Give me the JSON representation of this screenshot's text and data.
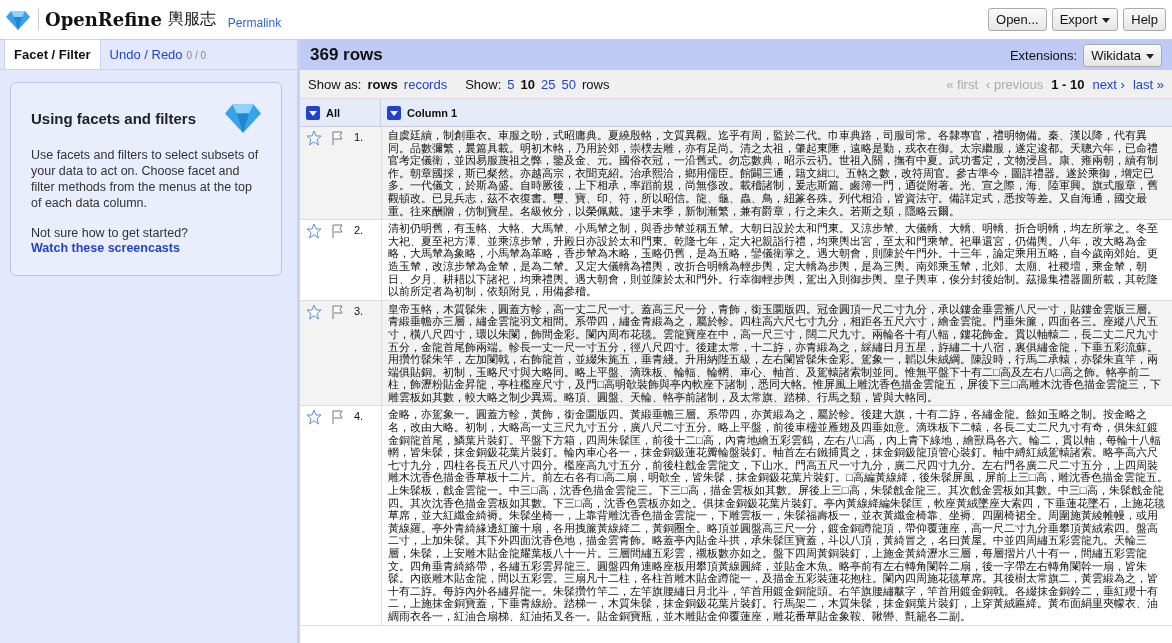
{
  "header": {
    "logo": "OpenRefine",
    "project_name": "輿服志",
    "permalink": "Permalink",
    "buttons": [
      {
        "label": "Open...",
        "has_menu": false
      },
      {
        "label": "Export",
        "has_menu": true
      },
      {
        "label": "Help",
        "has_menu": false
      }
    ]
  },
  "left_panel": {
    "tabs": [
      {
        "label": "Facet / Filter",
        "selected": true
      },
      {
        "label": "Undo / Redo",
        "count": "0 / 0",
        "selected": false
      }
    ],
    "help_card": {
      "title": "Using facets and filters",
      "body": "Use facets and filters to select subsets of your data to act on. Choose facet and filter methods from the menus at the top of each data column.",
      "question": "Not sure how to get started?",
      "link": "Watch these screencasts"
    }
  },
  "main": {
    "row_count": "369 rows",
    "extensions_label": "Extensions:",
    "extensions_button": "Wikidata",
    "show_as_label": "Show as:",
    "show_as": [
      {
        "label": "rows",
        "selected": true
      },
      {
        "label": "records",
        "selected": false
      }
    ],
    "show_label": "Show:",
    "page_sizes": [
      {
        "label": "5",
        "selected": false
      },
      {
        "label": "10",
        "selected": true
      },
      {
        "label": "25",
        "selected": false
      },
      {
        "label": "50",
        "selected": false
      }
    ],
    "rows_label": "rows",
    "pager": {
      "back": [
        {
          "label": "« first",
          "disabled": true
        },
        {
          "label": "‹ previous",
          "disabled": true
        }
      ],
      "range": "1 - 10",
      "forward": [
        {
          "label": "next ›",
          "disabled": false
        },
        {
          "label": "last »",
          "disabled": false
        }
      ]
    },
    "columns": [
      {
        "label": "All"
      },
      {
        "label": "Column 1"
      }
    ],
    "rows": [
      {
        "number": "1.",
        "starred": false,
        "flagged": false,
        "text": "自虞廷續，制創垂衣。車服之昐，式昭庸典。夏繞殷輅，文質異觀。迄乎有周，監於二代。巾車典路，司服司常。各隸專官，禮明物備。秦、漢以降，代有異同。品數彌繁，曩篇具載。明初木輅，乃用於郊，崇樸去雕，亦有足尚。清之太祖，肇起東陲，遠略是勤，戎衣在御。太宗繼服，遂定逡都。天聰六年，已命禮官考定儀衛，並因易服蔑祖之弊，鑒及金、元。國俗衣冠，一沿舊式。勿忘數典，昭示云礽。世祖入關，撫有中夏。武功耆定，文物浸昌。康、雍兩朝，續有制作。朝章國採，斯已粲然。亦越高宗，衣聞克紹。治承熙洽，鄉用儒臣。館闢三通，籍文緝□。五輅之數，改符周官。參古準今，圖詳禮器。遂於乘御，增定已多。一代儀文，於斯為盛。自時厥後，上下相承，率蹈前規，尚無俢改。載稽諸制，爰志斯篇。鹵簿一門，迺從附著。光、宣之際，海、陸軍興。旗式服章，舊觀頓改。已見兵志，茲不衣復書。璽、寶、印、符，所以昭信。龍、龜、蟲、鳥，紐篆各殊。列代相沿，皆資法守。備詳定式，悉按等差。又自海通，國交最重。往來酬贈，仿制寶星。名級攸分，以榮佩戴。逮乎末季，新制漸繁，兼有爵章，行之未久。若斯之類，隱略云爾。"
      },
      {
        "number": "2.",
        "starred": false,
        "flagged": false,
        "text": "清初仍明舊，有玉輅、大輅、大馬輦、小馬輦之制，與香步輦並稱五輦。大朝日設於太和門東。又涼步輦、大儀轎、大轎、明轎、折合明轎，均左所掌之。冬至大祀、夏至祀方澤、並乘涼步輦，升殿日亦設於太和門東。乾隆七年，定大祀親詣行禮，均乘輿出宮，至太和門乘輦。祀畢還宮，仍備輿。八年，改大略為金略，大馬輦為象略，小馬輦為革略，香步輦為木略，玉略仍舊，是為五略，鑾儀衛掌之。遇大朝會，則陳於午門外。十三年，論定乘用五略，自今歲南郊始。更造玉輦，改涼步輦為金輦，是為二輦。又定大儀轎為禮輿，改折合明轎為輕步輿，定大轎為步輿，是為三輿。南郊乘玉輦，北郊、太廟、社稷壇，乘金輦，朝日、夕月、耕耤以下諸祀，均乘禮輿。遇大朝會，則並陳於太和門外。行幸御輕步輿，駕出入則御步輿。皇子輿車，俟分封後始制。茲撮集禮器圖所載，其乾隆以前所定者為初制，依類附見，用備參稽。"
      },
      {
        "number": "3.",
        "starred": false,
        "flagged": false,
        "text": "皇帝玉輅，木質髹朱，圓蓋方軫，高一丈二尺一寸。蓋高三尺一分，青飾，銜玉圜版四。冠金圓頂一尺二寸九分，承以鏤金垂雲簷八尺一寸，貼鏤金雲版三層。青緞垂幨亦三層，繡金雲龍羽文相間。系帶四，繡金青緞為之，屬於軫。四柱高六尺七寸九分，相距各五尺六寸，繪金雲龍。門垂朱簾，四面各三。座縱八尺五寸，橫八尺四寸，環以朱闌，飾間金彩。闌內周布花毯。雲龍寶座在中，高一尺三寸，闊二尺九寸。兩輪各十有八輻，鏤花飾金。貫以軸轅二，長二丈二尺九寸五分，金龍首尾飾兩端。軫長一丈一尺一寸五分，徑八尺四寸。後建太常，十二斿，亦青緞為之，綵繡日月五星，斿繡二十八宿，裏俱繡金龍，下垂五彩流蘇。用攢竹髹朱竿，左加闌戟，右飾龍首，並綴朱旄五，垂青綫。升用納陛五級，左右闌皆髹朱金彩。駕象一，韜以朱絨綱。陳設時，行馬二承轅，亦髹朱直竿，兩端俱貼銅。初制，玉略尺寸與大略同。略上平盤、滴珠板、輪輻、輪輞、車心、軸首、及駕轅諸索制並同。惟無平盤下十有二□高及左右八□高之飾。輅亭前二柱，飾瀝粉貼金昇龍，亭柱檻座尺寸，及門□高明欹裝飾與亭內軟座下諸制，悉同大輅。惟屏風上雕沈香色描金雲龍五，屏後下三□高雕木沈香色描金雲龍三，下雕雲板如其數，較大略之制少異焉。略頂、圓盤、天輪、輅亭前諸制，及太常旗、踏梯、行馬之類，皆與大輅同。"
      },
      {
        "number": "4.",
        "starred": false,
        "flagged": false,
        "text": "金略，亦駕象一。圓蓋方軫，黃飾，銜金圜版四。黃緞垂幨三層。系帶四，亦黃緞為之，屬於軫。後建大旗，十有二斿，各繡金龍。餘如玉略之制。按金略之名，改由大略。初制，大略高一丈三尺九寸五分，廣八尺二寸五分。略上平盤，前後車欞並雁翅及四垂如意。滴珠板下二轅，各長二丈二尺九寸有奇，俱朱紅鍍金銅龍首尾，鱗葉片裝釘。平盤下方箱，四周朱髹匡，前後十二□高，內青地繪五彩雲鶴，左右八□高，內上青下綠地，繪獸爲各六。輪二，貫以軸，每輪十八輻輞，皆朱髹，抹金銅鈒花葉片裝釘。輪內車心各一，抹金銅鈒蓮花瓣輪盤裝釘。軸首左右鐵捕貫之，抹金銅鈒龍頂管心裝釘。軸中縛紅絨駕轅諸索。略亭高六尺七寸九分，四柱各長五尺八寸四分。檻座高九寸五分，前後柱戧金雲龍文，下山水。門高五尺一寸九分，廣二尺四寸九分。左右門各廣二尺二寸五分，上四周裝雕木沈香色描金香草板十二片。前左右各有□高二扇，明欹全，皆朱髹，抹金銅鈒花葉片裝釘。□高編黃線絳，後朱髹屏風，屏前上三□高，雕沈香色描金雲龍五。上朱髹板，戧金雲龍一。中三□高，沈香色描金雲龍三。下三□高，描金雲板如其數。屏後上三□高，朱髹戧金龍三。其次戧金雲板如其數。中三□高，朱髹戧金龍四。其次沈香色描金雲板如其數。下三□高，沈香色雲板亦如之。俱抹金銅鈒花葉片裝釘。亭內黃線絳編朱髹匡，軟座黃絨墜座大索四，下垂蓮花墜石，上施花毯草席，並大紅纖金綺褥。朱髹坐椅一，上靠背雕沈香色描金雲龍一，下雕雲板一，朱髹福壽板一，並衣黃纖金椅靠、坐褥、四圍椅裙全。周圍施黃綾帷幔，或用黃線羅。亭外青綺緣邊紅簾十扇，各用拽簾黃線絳二，黃銅圈全。略頂並圓盤高三尺一分，鍍金銅蹲龍頂，帶仰覆蓮座，高一尺二寸九分垂攀頂黃絨索四。盤高二寸，上加朱髹。其下外四面沈香色地，描金雲青飾。略蓋亭內貼金斗拱，承朱髹匡寶蓋，斗以八頂，黃綺冒之，名曰黃屋。中並四周繡五彩雲龍九。天輪三層，朱髹，上安雕木貼金龍耀葉板八十一片。三層間繡五彩雲，襯板數亦如之。盤下四周黃銅裝釘，上施金黃綺瀝水三層，每層摺片八十有一，間繡五彩雲龍文。四角垂青綺絡帶，各繡五彩雲昇龍三。圓盤四角連略座板用攀頂黃線圓絳，並貼金木魚。略亭前有左右轉角闌幹二扇，後一字帶左右轉角闌幹一扇，皆朱髹。內嵌雕木貼金龍，間以五彩雲。三扇凡十二柱，各柱首雕木貼金蹲龍一，及描金五彩裝蓮花抱柱。闌內四周施花毯草席。其後樹太常旗二，黃雲緞為之，皆十有二斿。每斿內外各繡昇龍一。朱髹攢竹竿二，左竿旗腰繡日月北斗，竿首用鍍金銅龍頭。右竿旗腰繡黻字，竿首用鍍金銅戟。各綴抹金銅鈴二，垂紅纓十有二，上施抹金銅寶蓋，下垂青線紛。踏梯一，木質朱髹，抹金銅鈒花葉片裝釘。行馬架二，木質朱髹，抹金銅葉片裝釘，上穿黃絨匾絳。黃布面絹里夾幪衣、油綢雨衣各一，紅油合扇梯、紅油拓叉各一。貼金銅寶瓶，並木雕貼金仰覆蓮座，雕花番草貼金象鞍、鞦轡、氈籠各二副。"
      }
    ]
  }
}
